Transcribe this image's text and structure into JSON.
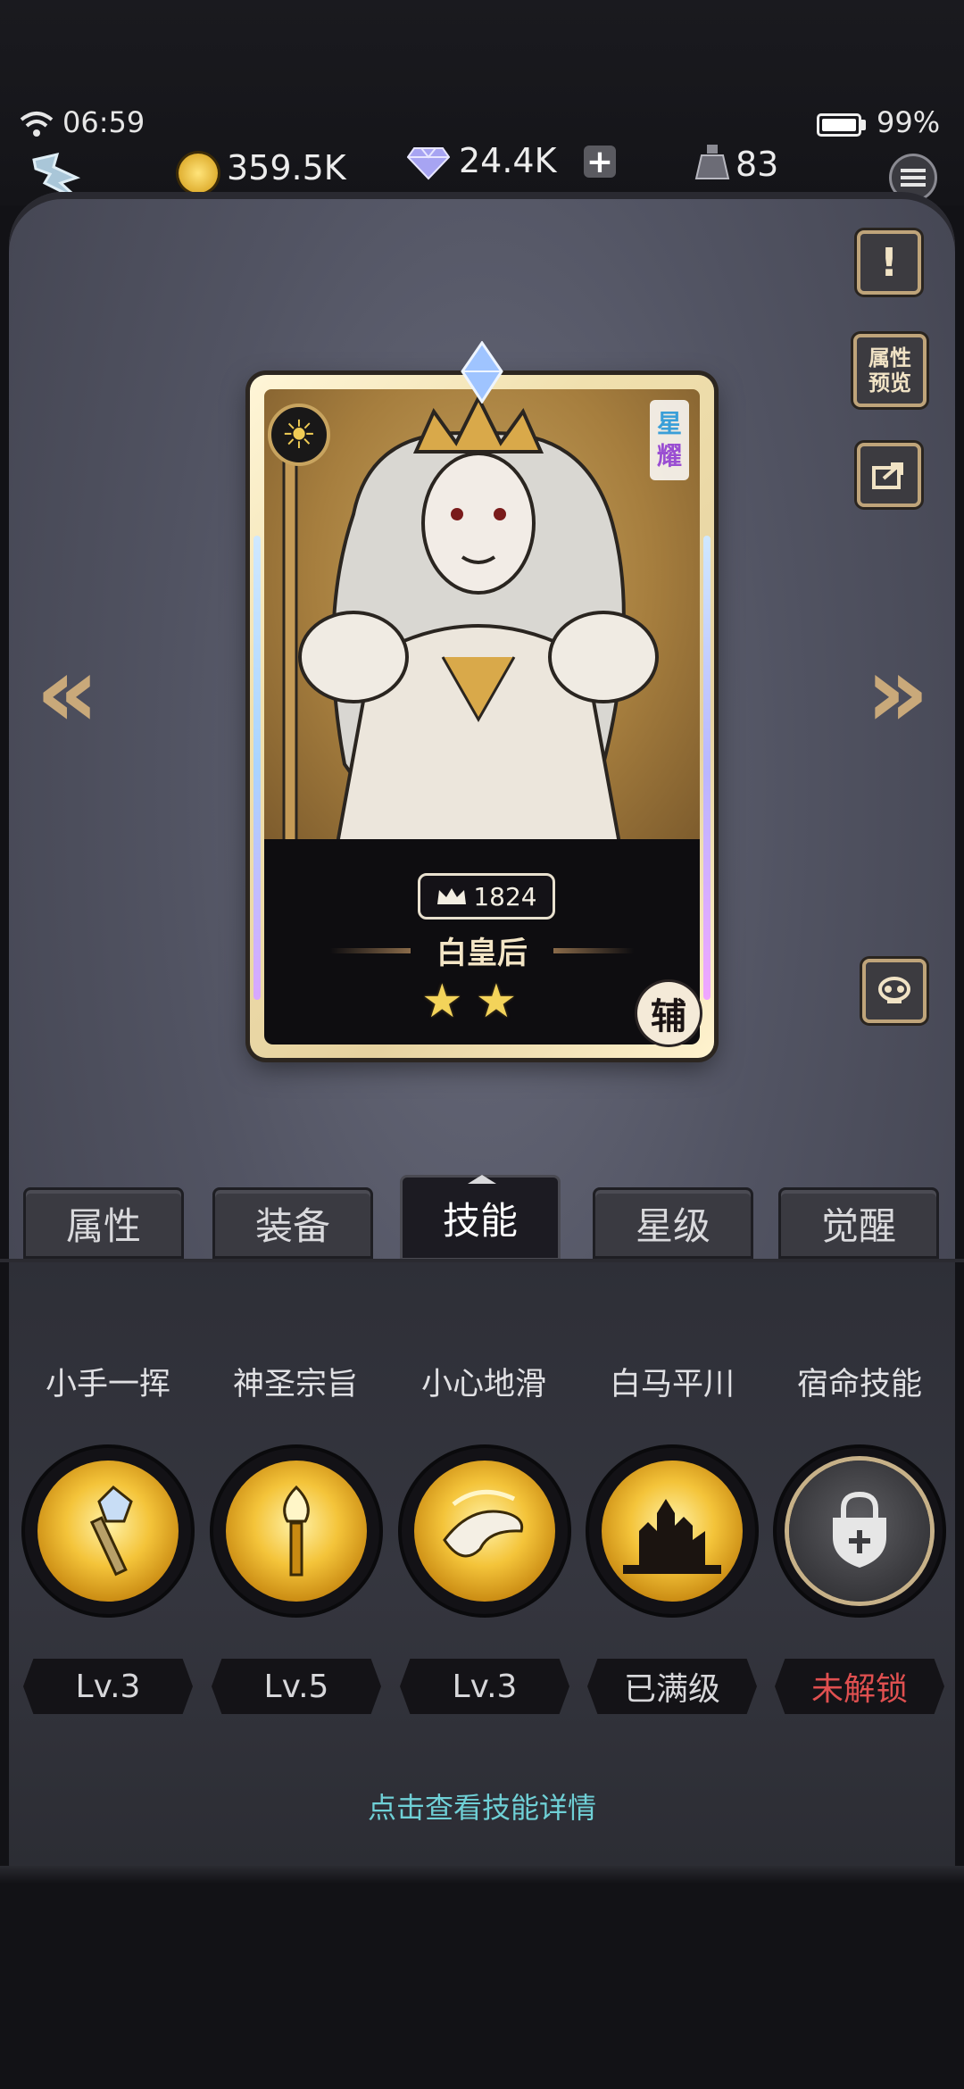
{
  "status_bar": {
    "time": "06:59",
    "battery": "99%"
  },
  "resources": {
    "gold": "359.5K",
    "diamonds": "24.4K",
    "potion": "83"
  },
  "side_buttons": {
    "attribute_preview": "属性\n预览"
  },
  "hero": {
    "power": "1824",
    "name": "白皇后",
    "stars": 2,
    "rarity": [
      "星",
      "耀"
    ],
    "role": "辅"
  },
  "tabs": [
    {
      "label": "属性"
    },
    {
      "label": "装备"
    },
    {
      "label": "技能"
    },
    {
      "label": "星级"
    },
    {
      "label": "觉醒"
    }
  ],
  "active_tab": "技能",
  "skills": [
    {
      "name": "小手一挥",
      "level": "Lv.3",
      "icon": "scepter-icon"
    },
    {
      "name": "神圣宗旨",
      "level": "Lv.5",
      "icon": "torch-icon"
    },
    {
      "name": "小心地滑",
      "level": "Lv.3",
      "icon": "slipping-hand-icon"
    },
    {
      "name": "白马平川",
      "level": "已满级",
      "icon": "castle-icon"
    },
    {
      "name": "宿命技能",
      "level": "未解锁",
      "icon": "locked-shield-icon"
    }
  ],
  "detail_link": "点击查看技能详情",
  "colors": {
    "accent_gold": "#c9a97a",
    "locked_red": "#e05050",
    "link_cyan": "#6fd0d6"
  }
}
